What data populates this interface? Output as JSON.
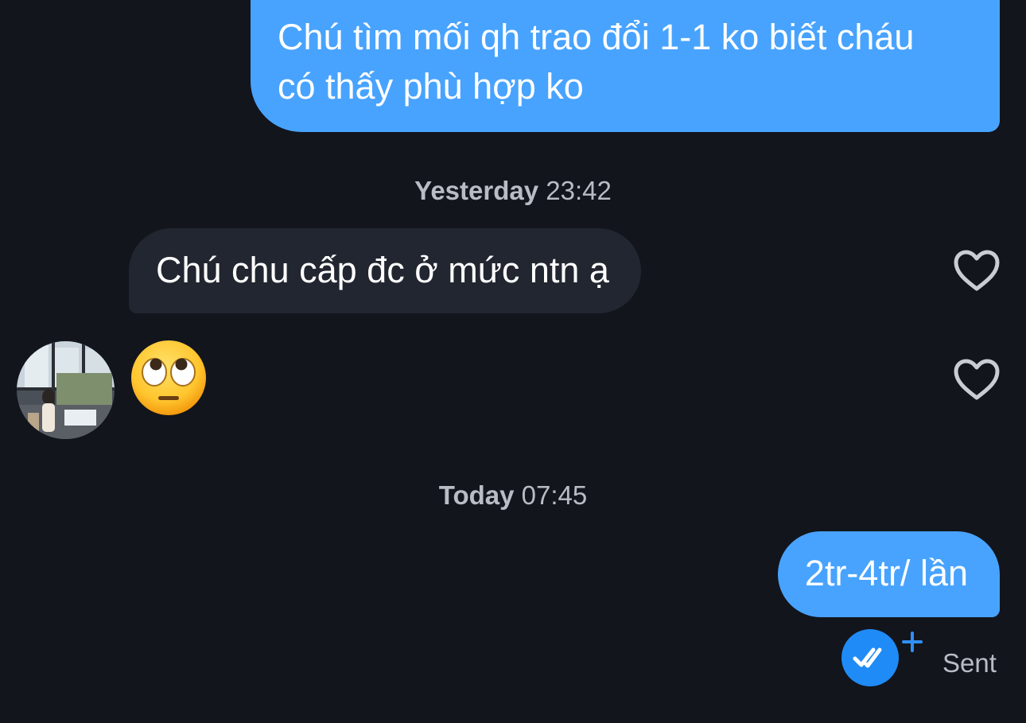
{
  "messages": {
    "m1": {
      "text_line1": "Chú tìm mối qh trao đổi 1-1 ko biết cháu",
      "text_line2": "có thấy phù hợp ko"
    },
    "m2": {
      "text": "Chú chu cấp đc ở mức ntn ạ"
    },
    "m4": {
      "text": "2tr-4tr/ lần"
    }
  },
  "timestamps": {
    "t1": {
      "day": "Yesterday",
      "time": "23:42"
    },
    "t2": {
      "day": "Today",
      "time": "07:45"
    }
  },
  "reactions": {
    "emoji": "face-with-rolling-eyes"
  },
  "status": {
    "label": "Sent"
  },
  "icons": {
    "heart": "heart-outline-icon",
    "read": "double-check-icon",
    "plus": "plus-icon"
  },
  "colors": {
    "background": "#12151c",
    "outgoing_bubble": "#48a3fe",
    "incoming_bubble": "#222630",
    "timestamp_text": "#b9bcc4",
    "read_badge": "#1f8bf6"
  }
}
